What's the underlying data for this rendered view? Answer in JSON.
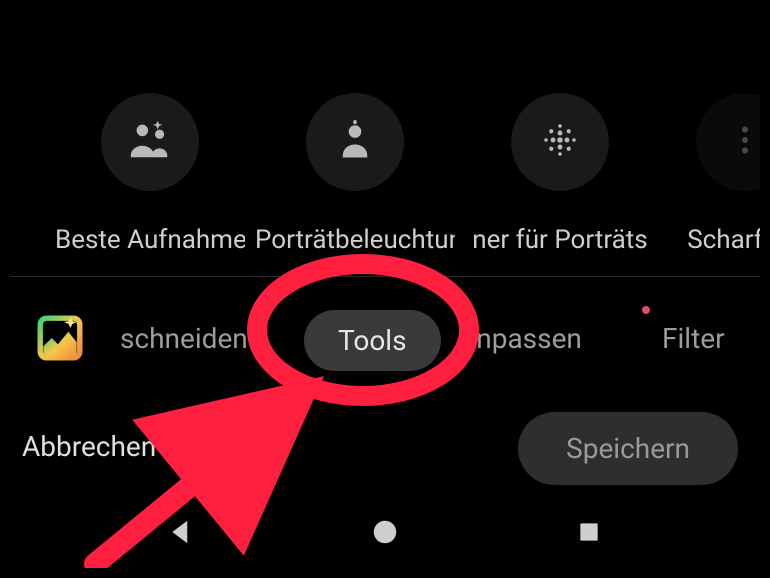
{
  "tools": [
    {
      "icon": "best-take-icon",
      "label": "Beste Aufnahme"
    },
    {
      "icon": "portrait-light-icon",
      "label": "Porträtbeleuchtung"
    },
    {
      "icon": "portrait-blur-icon",
      "label": "ner für Porträts"
    },
    {
      "icon": "sharpen-icon",
      "label": "Scharf"
    }
  ],
  "tabs": {
    "auto_icon": "auto-enhance-icon",
    "items": [
      {
        "label": "schneiden",
        "active": false
      },
      {
        "label": "Tools",
        "active": true
      },
      {
        "label": "Anpassen",
        "active": false
      },
      {
        "label": "Filter",
        "active": false
      }
    ]
  },
  "actions": {
    "cancel_label": "Abbrechen",
    "save_label": "Speichern"
  },
  "annotation": {
    "highlight_target": "tab-tools",
    "color": "#ff1f3e"
  }
}
